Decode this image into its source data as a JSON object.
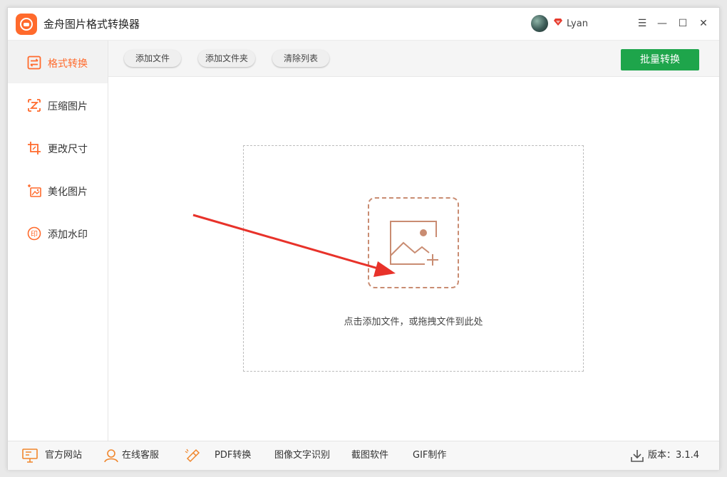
{
  "app": {
    "title": "金舟图片格式转换器"
  },
  "user": {
    "name": "Lyan"
  },
  "window_controls": {
    "menu": "☰",
    "minimize": "—",
    "maximize": "☐",
    "close": "✕"
  },
  "sidebar": {
    "items": [
      {
        "label": "格式转换",
        "icon": "format-convert-icon",
        "active": true
      },
      {
        "label": "压缩图片",
        "icon": "compress-icon",
        "active": false
      },
      {
        "label": "更改尺寸",
        "icon": "resize-icon",
        "active": false
      },
      {
        "label": "美化图片",
        "icon": "beautify-icon",
        "active": false
      },
      {
        "label": "添加水印",
        "icon": "watermark-icon",
        "active": false
      }
    ],
    "watermark_glyph": "印"
  },
  "toolbar": {
    "add_file": "添加文件",
    "add_folder": "添加文件夹",
    "clear_list": "清除列表",
    "batch_convert": "批量转换"
  },
  "main": {
    "drop_hint": "点击添加文件，或拖拽文件到此处"
  },
  "footer": {
    "official_site": "官方网站",
    "online_service": "在线客服",
    "pdf_convert": "PDF转换",
    "ocr": "图像文字识别",
    "screenshot": "截图软件",
    "gif": "GIF制作",
    "version": "版本：3.1.4"
  },
  "colors": {
    "accent": "#ff6a2c",
    "batch_button": "#1ea54b",
    "arrow": "#e8322a",
    "add_box": "#c98c72"
  }
}
